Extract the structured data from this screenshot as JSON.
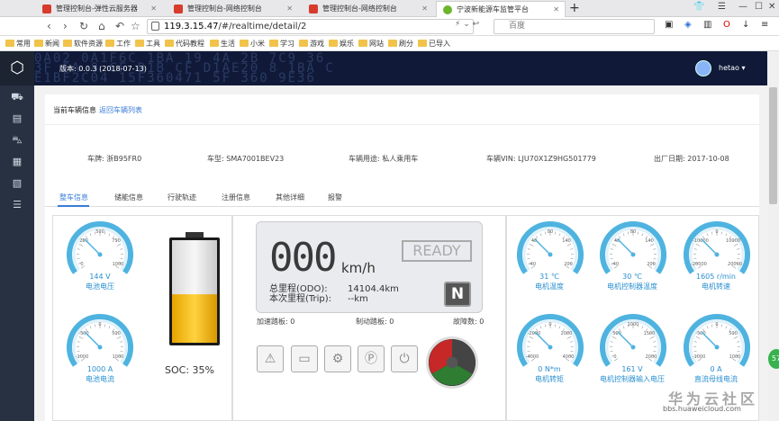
{
  "browser": {
    "tabs": [
      {
        "title": "管理控制台-弹性云服务器"
      },
      {
        "title": "管理控制台-网络控制台"
      },
      {
        "title": "管理控制台-网络控制台"
      },
      {
        "title": "宁波新能源车监管平台"
      }
    ],
    "url_host": "119.3.15.47",
    "url_path": "/#/realtime/detail/2",
    "search_engine": "百度",
    "bookmarks": [
      "常用",
      "新闻",
      "软件资源",
      "工作",
      "工具",
      "代码教程",
      "生活",
      "小米",
      "学习",
      "游戏",
      "娱乐",
      "网站",
      "刷分",
      "已导入"
    ]
  },
  "header": {
    "version": "版本: 0.0.3 (2018-07-13)",
    "user": "hetao",
    "hex_lines": [
      "0A02 0A1F6C 1BA 19 4A 2B 7C9 36",
      "3F 5A 8 CF D1B CF D1AE20 8 1BA C",
      "E1BF2C04 15F360471 5F 360 9E36"
    ]
  },
  "vehicle": {
    "section_title": "当前车辆信息",
    "back_link": "返回车辆列表",
    "plate": "车牌: 浙B95FR0",
    "model": "车型: SMA7001BEV23",
    "usage": "车辆用途: 私人乘用车",
    "vin": "车辆VIN: LJU70X1Z9HG501779",
    "date": "出厂日期: 2017-10-08"
  },
  "tabs": [
    "整车信息",
    "储能信息",
    "行驶轨迹",
    "注册信息",
    "其他详细",
    "报警"
  ],
  "gauges_left": [
    {
      "value": "144 V",
      "label": "电池电压",
      "ticks": [
        "250",
        "500",
        "750",
        "0",
        "1000"
      ]
    },
    {
      "value": "1000 A",
      "label": "电池电流",
      "ticks": [
        "-500",
        "0",
        "500",
        "-1000",
        "1000"
      ]
    }
  ],
  "battery": {
    "soc_label": "SOC: 35%",
    "soc": 0.35
  },
  "dashboard": {
    "speed": "000",
    "speed_unit": "km/h",
    "ready": "READY",
    "odo_label": "总里程(ODO):",
    "odo_value": "14104.4km",
    "trip_label": "本次里程(Trip):",
    "trip_value": "--km",
    "gear": "N",
    "accel": "加速踏板: 0",
    "brake": "制动踏板: 0",
    "fault": "故障数: 0"
  },
  "gauges_right": [
    {
      "value": "31 ℃",
      "label": "电机温度",
      "ticks": [
        "40",
        "80",
        "140",
        "-40",
        "200"
      ]
    },
    {
      "value": "30 ℃",
      "label": "电机控制器温度",
      "ticks": [
        "40",
        "80",
        "140",
        "-40",
        "200"
      ]
    },
    {
      "value": "1605 r/min",
      "label": "电机转速",
      "ticks": [
        "-10000",
        "0",
        "10000",
        "-20000",
        "20000"
      ]
    },
    {
      "value": "0 N*m",
      "label": "电机转矩",
      "ticks": [
        "-2000",
        "0",
        "2000",
        "-4000",
        "4000"
      ]
    },
    {
      "value": "161 V",
      "label": "电机控制器输入电压",
      "ticks": [
        "500",
        "1000",
        "1500",
        "0",
        "2000"
      ]
    },
    {
      "value": "0 A",
      "label": "直流母线电流",
      "ticks": [
        "-500",
        "0",
        "500",
        "-1000",
        "1000"
      ]
    }
  ],
  "watermark": "华为云社区",
  "watermark_url": "bbs.huaweicloud.com"
}
